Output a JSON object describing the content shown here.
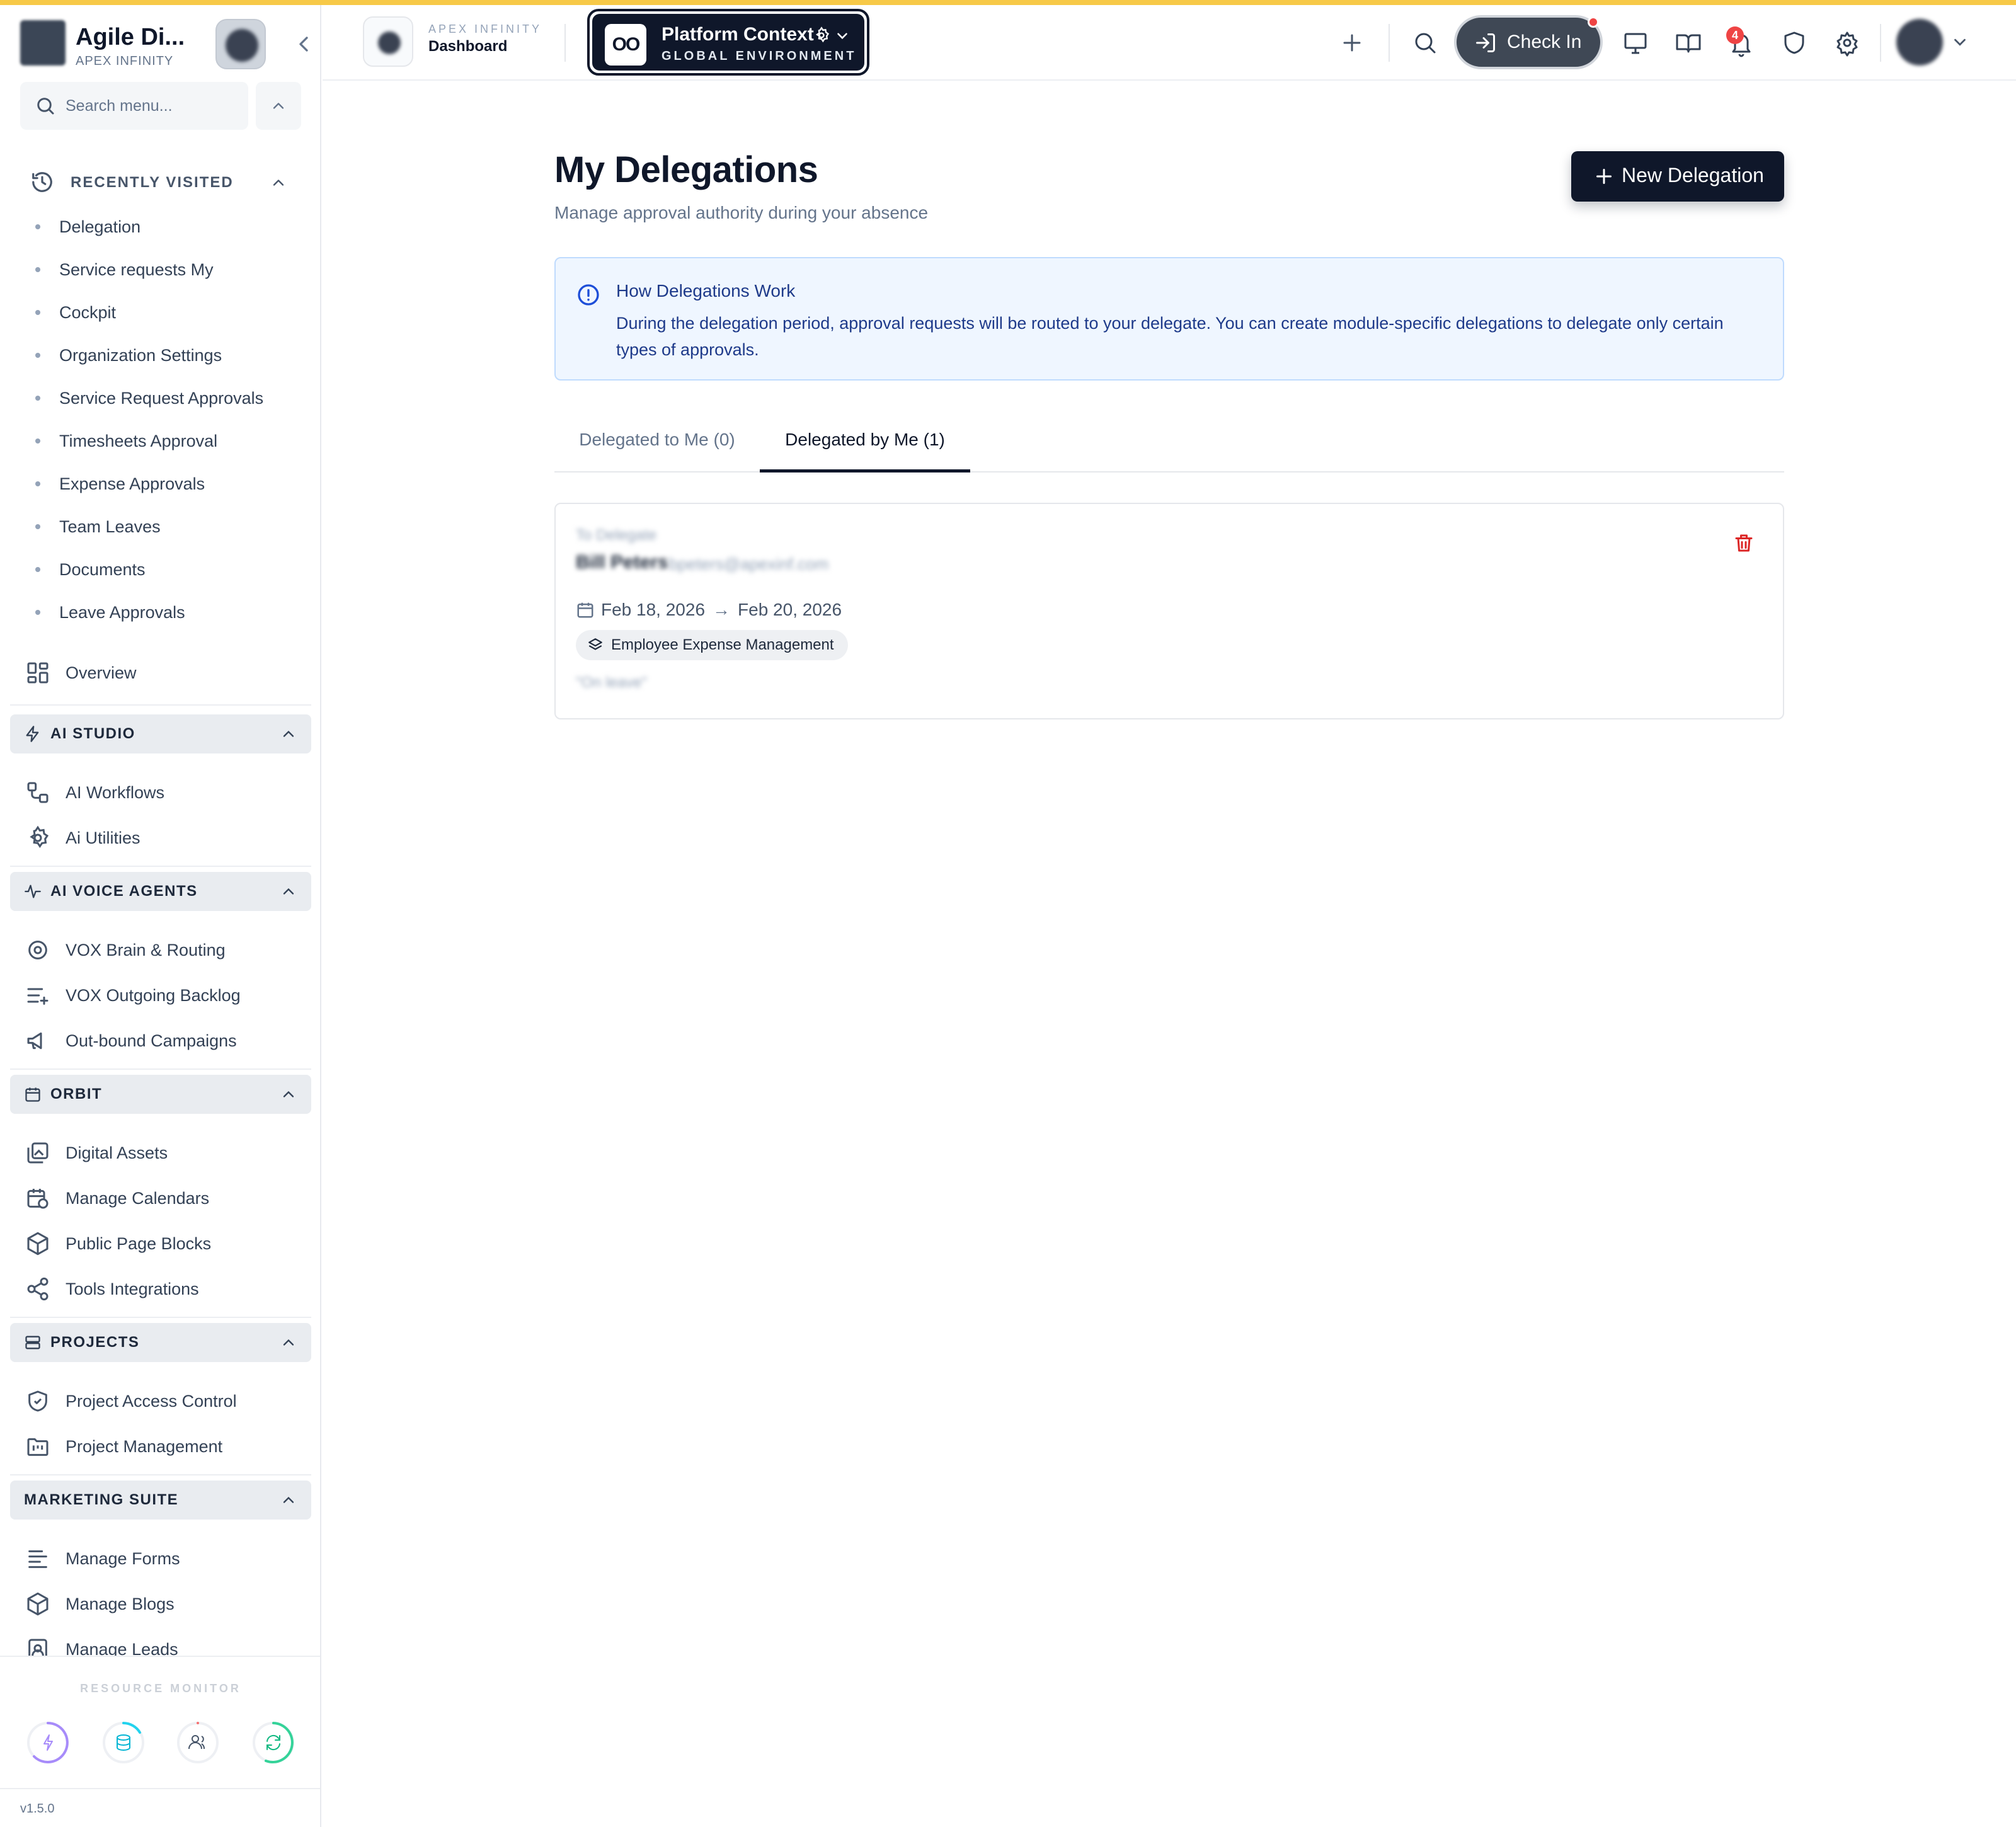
{
  "brand": {
    "name": "Agile Di...",
    "sub": "APEX INFINITY"
  },
  "search": {
    "placeholder": "Search menu..."
  },
  "recently_visited": {
    "label": "RECENTLY VISITED",
    "items": [
      "Delegation",
      "Service requests My",
      "Cockpit",
      "Organization Settings",
      "Service Request Approvals",
      "Timesheets Approval",
      "Expense Approvals",
      "Team Leaves",
      "Documents",
      "Leave Approvals"
    ]
  },
  "overview": {
    "label": "Overview"
  },
  "sections": {
    "ai_studio": {
      "label": "AI STUDIO",
      "items": [
        "AI Workflows",
        "Ai Utilities"
      ]
    },
    "ai_voice": {
      "label": "AI VOICE AGENTS",
      "items": [
        "VOX Brain & Routing",
        "VOX Outgoing Backlog",
        "Out-bound Campaigns"
      ]
    },
    "orbit": {
      "label": "ORBIT",
      "items": [
        "Digital Assets",
        "Manage Calendars",
        "Public Page Blocks",
        "Tools Integrations"
      ]
    },
    "projects": {
      "label": "PROJECTS",
      "items": [
        "Project Access Control",
        "Project Management"
      ]
    },
    "marketing": {
      "label": "MARKETING SUITE",
      "items": [
        "Manage Forms",
        "Manage Blogs",
        "Manage Leads"
      ]
    }
  },
  "resource_monitor": {
    "label": "RESOURCE MONITOR"
  },
  "version": "v1.5.0",
  "topbar": {
    "dash_sub": "APEX INFINITY",
    "dash_title": "Dashboard",
    "context_logo": "OO",
    "context_title": "Platform Context",
    "context_sub": "GLOBAL ENVIRONMENT",
    "checkin_label": "Check In",
    "notification_count": "4"
  },
  "page": {
    "title": "My Delegations",
    "subtitle": "Manage approval authority during your absence",
    "new_button": "New Delegation"
  },
  "info": {
    "title": "How Delegations Work",
    "body": "During the delegation period, approval requests will be routed to your delegate. You can create module-specific delegations to delegate only certain types of approvals."
  },
  "tabs": [
    {
      "label": "Delegated to Me (0)"
    },
    {
      "label": "Delegated by Me (1)"
    }
  ],
  "delegation": {
    "label": "To Delegate",
    "name": "Bill Peters",
    "email": "bpeters@apexinf.com",
    "start": "Feb 18, 2026",
    "arrow": "→",
    "end": "Feb 20, 2026",
    "module": "Employee Expense Management",
    "note": "\"On leave\""
  },
  "colors": {
    "accent": "#0f172a",
    "highlight": "#f7c948",
    "danger": "#ef4444",
    "info_bg": "#eff6ff"
  }
}
